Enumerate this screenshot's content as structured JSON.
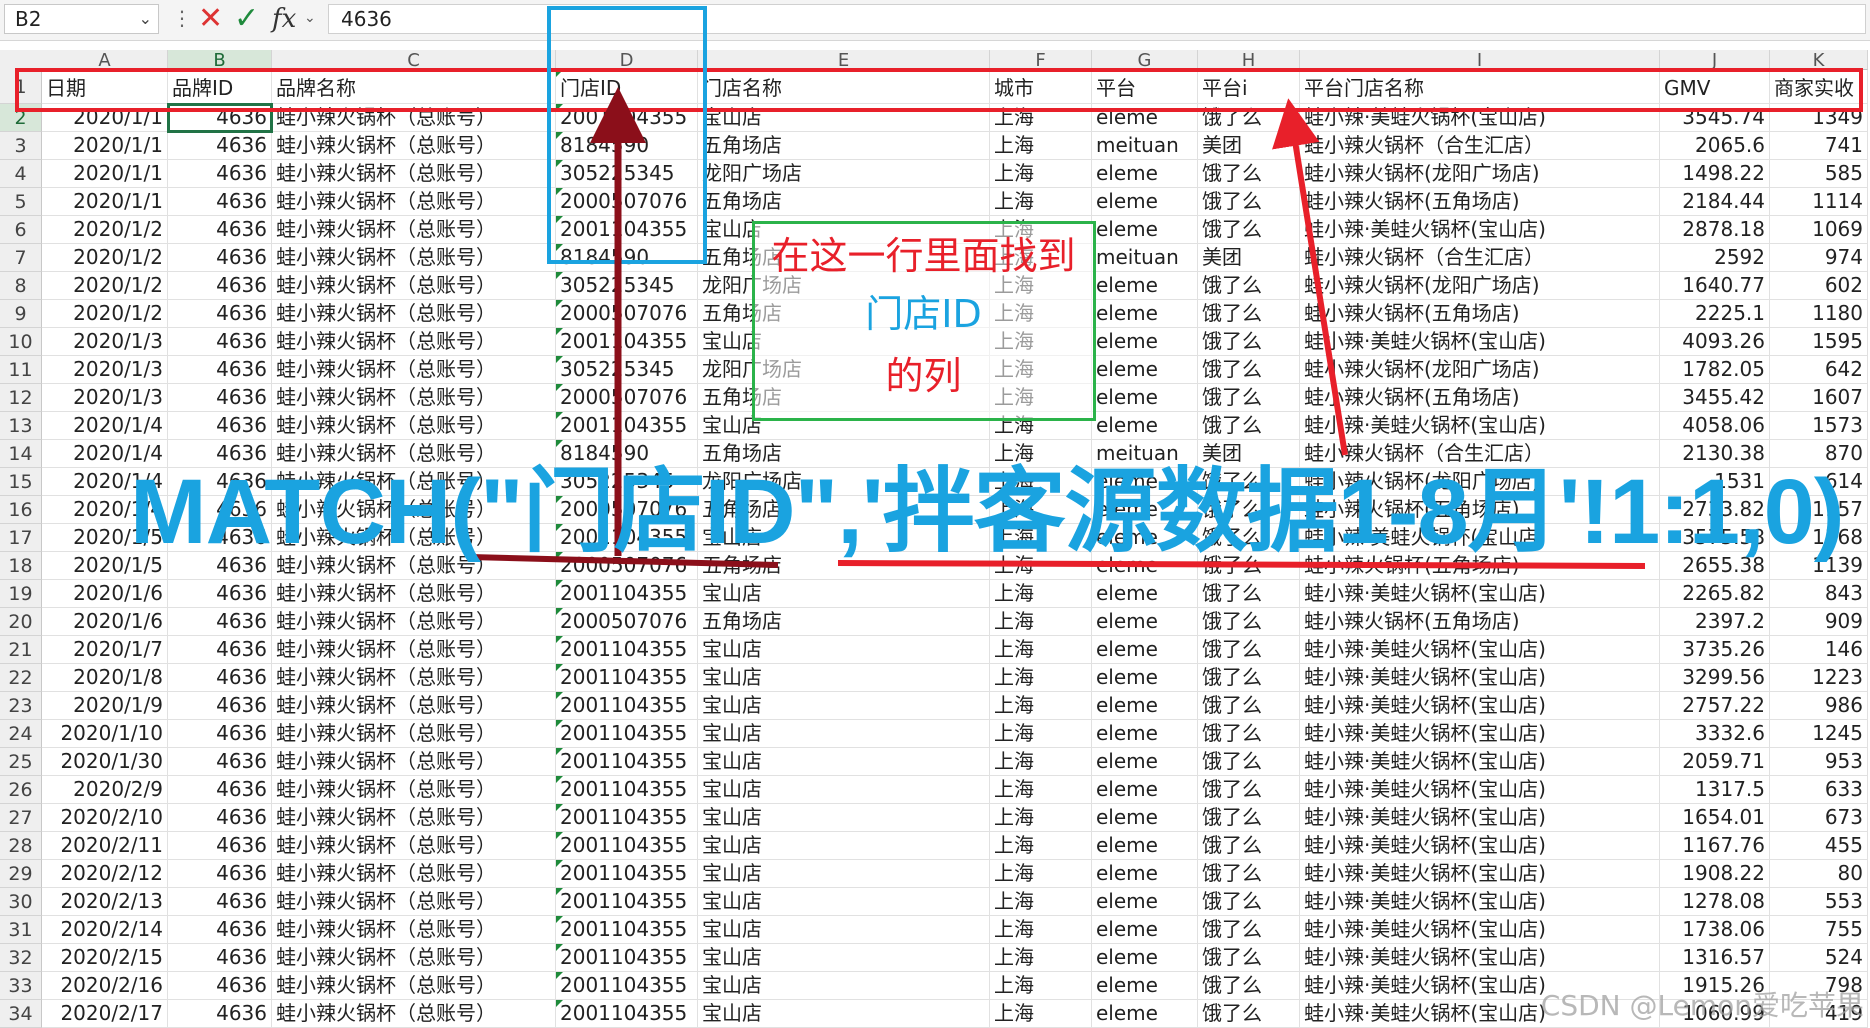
{
  "formula_bar": {
    "cell_ref": "B2",
    "value": "4636",
    "icons": [
      "more-icon",
      "cancel-x-icon",
      "confirm-check-icon",
      "function-fx-icon"
    ]
  },
  "columns": [
    "A",
    "B",
    "C",
    "D",
    "E",
    "F",
    "G",
    "H",
    "I",
    "J",
    "K"
  ],
  "header_row": {
    "num": "1",
    "cells": [
      "日期",
      "品牌ID",
      "品牌名称",
      "门店ID",
      "门店名称",
      "城市",
      "平台",
      "平台i",
      "平台门店名称",
      "GMV",
      "商家实收"
    ]
  },
  "rows": [
    {
      "n": "2",
      "c": [
        "2020/1/1",
        "4636",
        "蛙小辣火锅杯（总账号）",
        "2001104355",
        "宝山店",
        "上海",
        "eleme",
        "饿了么",
        "蛙小辣·美蛙火锅杯(宝山店)",
        "3545.74",
        "1349"
      ]
    },
    {
      "n": "3",
      "c": [
        "2020/1/1",
        "4636",
        "蛙小辣火锅杯（总账号）",
        "8184590",
        "五角场店",
        "上海",
        "meituan",
        "美团",
        "蛙小辣火锅杯（合生汇店）",
        "2065.6",
        "741"
      ]
    },
    {
      "n": "4",
      "c": [
        "2020/1/1",
        "4636",
        "蛙小辣火锅杯（总账号）",
        "305225345",
        "龙阳广场店",
        "上海",
        "eleme",
        "饿了么",
        "蛙小辣火锅杯(龙阳广场店)",
        "1498.22",
        "585"
      ]
    },
    {
      "n": "5",
      "c": [
        "2020/1/1",
        "4636",
        "蛙小辣火锅杯（总账号）",
        "2000507076",
        "五角场店",
        "上海",
        "eleme",
        "饿了么",
        "蛙小辣火锅杯(五角场店)",
        "2184.44",
        "1114"
      ]
    },
    {
      "n": "6",
      "c": [
        "2020/1/2",
        "4636",
        "蛙小辣火锅杯（总账号）",
        "2001104355",
        "宝山店",
        "上海",
        "eleme",
        "饿了么",
        "蛙小辣·美蛙火锅杯(宝山店)",
        "2878.18",
        "1069"
      ]
    },
    {
      "n": "7",
      "c": [
        "2020/1/2",
        "4636",
        "蛙小辣火锅杯（总账号）",
        "8184590",
        "五角场店",
        "上海",
        "meituan",
        "美团",
        "蛙小辣火锅杯（合生汇店）",
        "2592",
        "974"
      ]
    },
    {
      "n": "8",
      "c": [
        "2020/1/2",
        "4636",
        "蛙小辣火锅杯（总账号）",
        "305225345",
        "龙阳广场店",
        "上海",
        "eleme",
        "饿了么",
        "蛙小辣火锅杯(龙阳广场店)",
        "1640.77",
        "602"
      ]
    },
    {
      "n": "9",
      "c": [
        "2020/1/2",
        "4636",
        "蛙小辣火锅杯（总账号）",
        "2000507076",
        "五角场店",
        "上海",
        "eleme",
        "饿了么",
        "蛙小辣火锅杯(五角场店)",
        "2225.1",
        "1180"
      ]
    },
    {
      "n": "10",
      "c": [
        "2020/1/3",
        "4636",
        "蛙小辣火锅杯（总账号）",
        "2001104355",
        "宝山店",
        "上海",
        "eleme",
        "饿了么",
        "蛙小辣·美蛙火锅杯(宝山店)",
        "4093.26",
        "1595"
      ]
    },
    {
      "n": "11",
      "c": [
        "2020/1/3",
        "4636",
        "蛙小辣火锅杯（总账号）",
        "305225345",
        "龙阳广场店",
        "上海",
        "eleme",
        "饿了么",
        "蛙小辣火锅杯(龙阳广场店)",
        "1782.05",
        "642"
      ]
    },
    {
      "n": "12",
      "c": [
        "2020/1/3",
        "4636",
        "蛙小辣火锅杯（总账号）",
        "2000507076",
        "五角场店",
        "上海",
        "eleme",
        "饿了么",
        "蛙小辣火锅杯(五角场店)",
        "3455.42",
        "1607"
      ]
    },
    {
      "n": "13",
      "c": [
        "2020/1/4",
        "4636",
        "蛙小辣火锅杯（总账号）",
        "2001104355",
        "宝山店",
        "上海",
        "eleme",
        "饿了么",
        "蛙小辣·美蛙火锅杯(宝山店)",
        "4058.06",
        "1573"
      ]
    },
    {
      "n": "14",
      "c": [
        "2020/1/4",
        "4636",
        "蛙小辣火锅杯（总账号）",
        "8184590",
        "五角场店",
        "上海",
        "meituan",
        "美团",
        "蛙小辣火锅杯（合生汇店）",
        "2130.38",
        "870"
      ]
    },
    {
      "n": "15",
      "c": [
        "2020/1/4",
        "4636",
        "蛙小辣火锅杯（总账号）",
        "305225345",
        "龙阳广场店",
        "上海",
        "eleme",
        "饿了么",
        "蛙小辣火锅杯(龙阳广场店)",
        "1531",
        "614"
      ]
    },
    {
      "n": "16",
      "c": [
        "2020/1/4",
        "4636",
        "蛙小辣火锅杯（总账号）",
        "2000507076",
        "五角场店",
        "上海",
        "eleme",
        "饿了么",
        "蛙小辣火锅杯(五角场店)",
        "2733.82",
        "1157"
      ]
    },
    {
      "n": "17",
      "c": [
        "2020/1/5",
        "4636",
        "蛙小辣火锅杯（总账号）",
        "2001104355",
        "宝山店",
        "上海",
        "eleme",
        "饿了么",
        "蛙小辣·美蛙火锅杯(宝山店)",
        "3575.58",
        "1368"
      ]
    },
    {
      "n": "18",
      "c": [
        "2020/1/5",
        "4636",
        "蛙小辣火锅杯（总账号）",
        "2000507076",
        "五角场店",
        "上海",
        "eleme",
        "饿了么",
        "蛙小辣火锅杯(五角场店)",
        "2655.38",
        "1139"
      ]
    },
    {
      "n": "19",
      "c": [
        "2020/1/6",
        "4636",
        "蛙小辣火锅杯（总账号）",
        "2001104355",
        "宝山店",
        "上海",
        "eleme",
        "饿了么",
        "蛙小辣·美蛙火锅杯(宝山店)",
        "2265.82",
        "843"
      ]
    },
    {
      "n": "20",
      "c": [
        "2020/1/6",
        "4636",
        "蛙小辣火锅杯（总账号）",
        "2000507076",
        "五角场店",
        "上海",
        "eleme",
        "饿了么",
        "蛙小辣火锅杯(五角场店)",
        "2397.2",
        "909"
      ]
    },
    {
      "n": "21",
      "c": [
        "2020/1/7",
        "4636",
        "蛙小辣火锅杯（总账号）",
        "2001104355",
        "宝山店",
        "上海",
        "eleme",
        "饿了么",
        "蛙小辣·美蛙火锅杯(宝山店)",
        "3735.26",
        "146"
      ]
    },
    {
      "n": "22",
      "c": [
        "2020/1/8",
        "4636",
        "蛙小辣火锅杯（总账号）",
        "2001104355",
        "宝山店",
        "上海",
        "eleme",
        "饿了么",
        "蛙小辣·美蛙火锅杯(宝山店)",
        "3299.56",
        "1223"
      ]
    },
    {
      "n": "23",
      "c": [
        "2020/1/9",
        "4636",
        "蛙小辣火锅杯（总账号）",
        "2001104355",
        "宝山店",
        "上海",
        "eleme",
        "饿了么",
        "蛙小辣·美蛙火锅杯(宝山店)",
        "2757.22",
        "986"
      ]
    },
    {
      "n": "24",
      "c": [
        "2020/1/10",
        "4636",
        "蛙小辣火锅杯（总账号）",
        "2001104355",
        "宝山店",
        "上海",
        "eleme",
        "饿了么",
        "蛙小辣·美蛙火锅杯(宝山店)",
        "3332.6",
        "1245"
      ]
    },
    {
      "n": "25",
      "c": [
        "2020/1/30",
        "4636",
        "蛙小辣火锅杯（总账号）",
        "2001104355",
        "宝山店",
        "上海",
        "eleme",
        "饿了么",
        "蛙小辣·美蛙火锅杯(宝山店)",
        "2059.71",
        "953"
      ]
    },
    {
      "n": "26",
      "c": [
        "2020/2/9",
        "4636",
        "蛙小辣火锅杯（总账号）",
        "2001104355",
        "宝山店",
        "上海",
        "eleme",
        "饿了么",
        "蛙小辣·美蛙火锅杯(宝山店)",
        "1317.5",
        "633"
      ]
    },
    {
      "n": "27",
      "c": [
        "2020/2/10",
        "4636",
        "蛙小辣火锅杯（总账号）",
        "2001104355",
        "宝山店",
        "上海",
        "eleme",
        "饿了么",
        "蛙小辣·美蛙火锅杯(宝山店)",
        "1654.01",
        "673"
      ]
    },
    {
      "n": "28",
      "c": [
        "2020/2/11",
        "4636",
        "蛙小辣火锅杯（总账号）",
        "2001104355",
        "宝山店",
        "上海",
        "eleme",
        "饿了么",
        "蛙小辣·美蛙火锅杯(宝山店)",
        "1167.76",
        "455"
      ]
    },
    {
      "n": "29",
      "c": [
        "2020/2/12",
        "4636",
        "蛙小辣火锅杯（总账号）",
        "2001104355",
        "宝山店",
        "上海",
        "eleme",
        "饿了么",
        "蛙小辣·美蛙火锅杯(宝山店)",
        "1908.22",
        "80"
      ]
    },
    {
      "n": "30",
      "c": [
        "2020/2/13",
        "4636",
        "蛙小辣火锅杯（总账号）",
        "2001104355",
        "宝山店",
        "上海",
        "eleme",
        "饿了么",
        "蛙小辣·美蛙火锅杯(宝山店)",
        "1278.08",
        "553"
      ]
    },
    {
      "n": "31",
      "c": [
        "2020/2/14",
        "4636",
        "蛙小辣火锅杯（总账号）",
        "2001104355",
        "宝山店",
        "上海",
        "eleme",
        "饿了么",
        "蛙小辣·美蛙火锅杯(宝山店)",
        "1738.06",
        "755"
      ]
    },
    {
      "n": "32",
      "c": [
        "2020/2/15",
        "4636",
        "蛙小辣火锅杯（总账号）",
        "2001104355",
        "宝山店",
        "上海",
        "eleme",
        "饿了么",
        "蛙小辣·美蛙火锅杯(宝山店)",
        "1316.57",
        "524"
      ]
    },
    {
      "n": "33",
      "c": [
        "2020/2/16",
        "4636",
        "蛙小辣火锅杯（总账号）",
        "2001104355",
        "宝山店",
        "上海",
        "eleme",
        "饿了么",
        "蛙小辣·美蛙火锅杯(宝山店)",
        "1915.26",
        "798"
      ]
    },
    {
      "n": "34",
      "c": [
        "2020/2/17",
        "4636",
        "蛙小辣火锅杯（总账号）",
        "2001104355",
        "宝山店",
        "上海",
        "eleme",
        "饿了么",
        "蛙小辣·美蛙火锅杯(宝山店)",
        "1060.99",
        "419"
      ]
    }
  ],
  "annotations": {
    "note_line1": "在这一行里面找到",
    "note_line2": "门店ID",
    "note_line3": "的列",
    "formula_text": "MATCH(\"门店ID\",'拌客源数据1-8月'!1:1,0)",
    "watermark": "CSDN @Lemon爱吃苹果"
  },
  "colors": {
    "annotation_red": "#e8202a",
    "annotation_blue": "#1aa3e0",
    "annotation_green": "#2bb34a",
    "arrow_dark_red": "#8b0f1a",
    "selection_green": "#217346"
  }
}
